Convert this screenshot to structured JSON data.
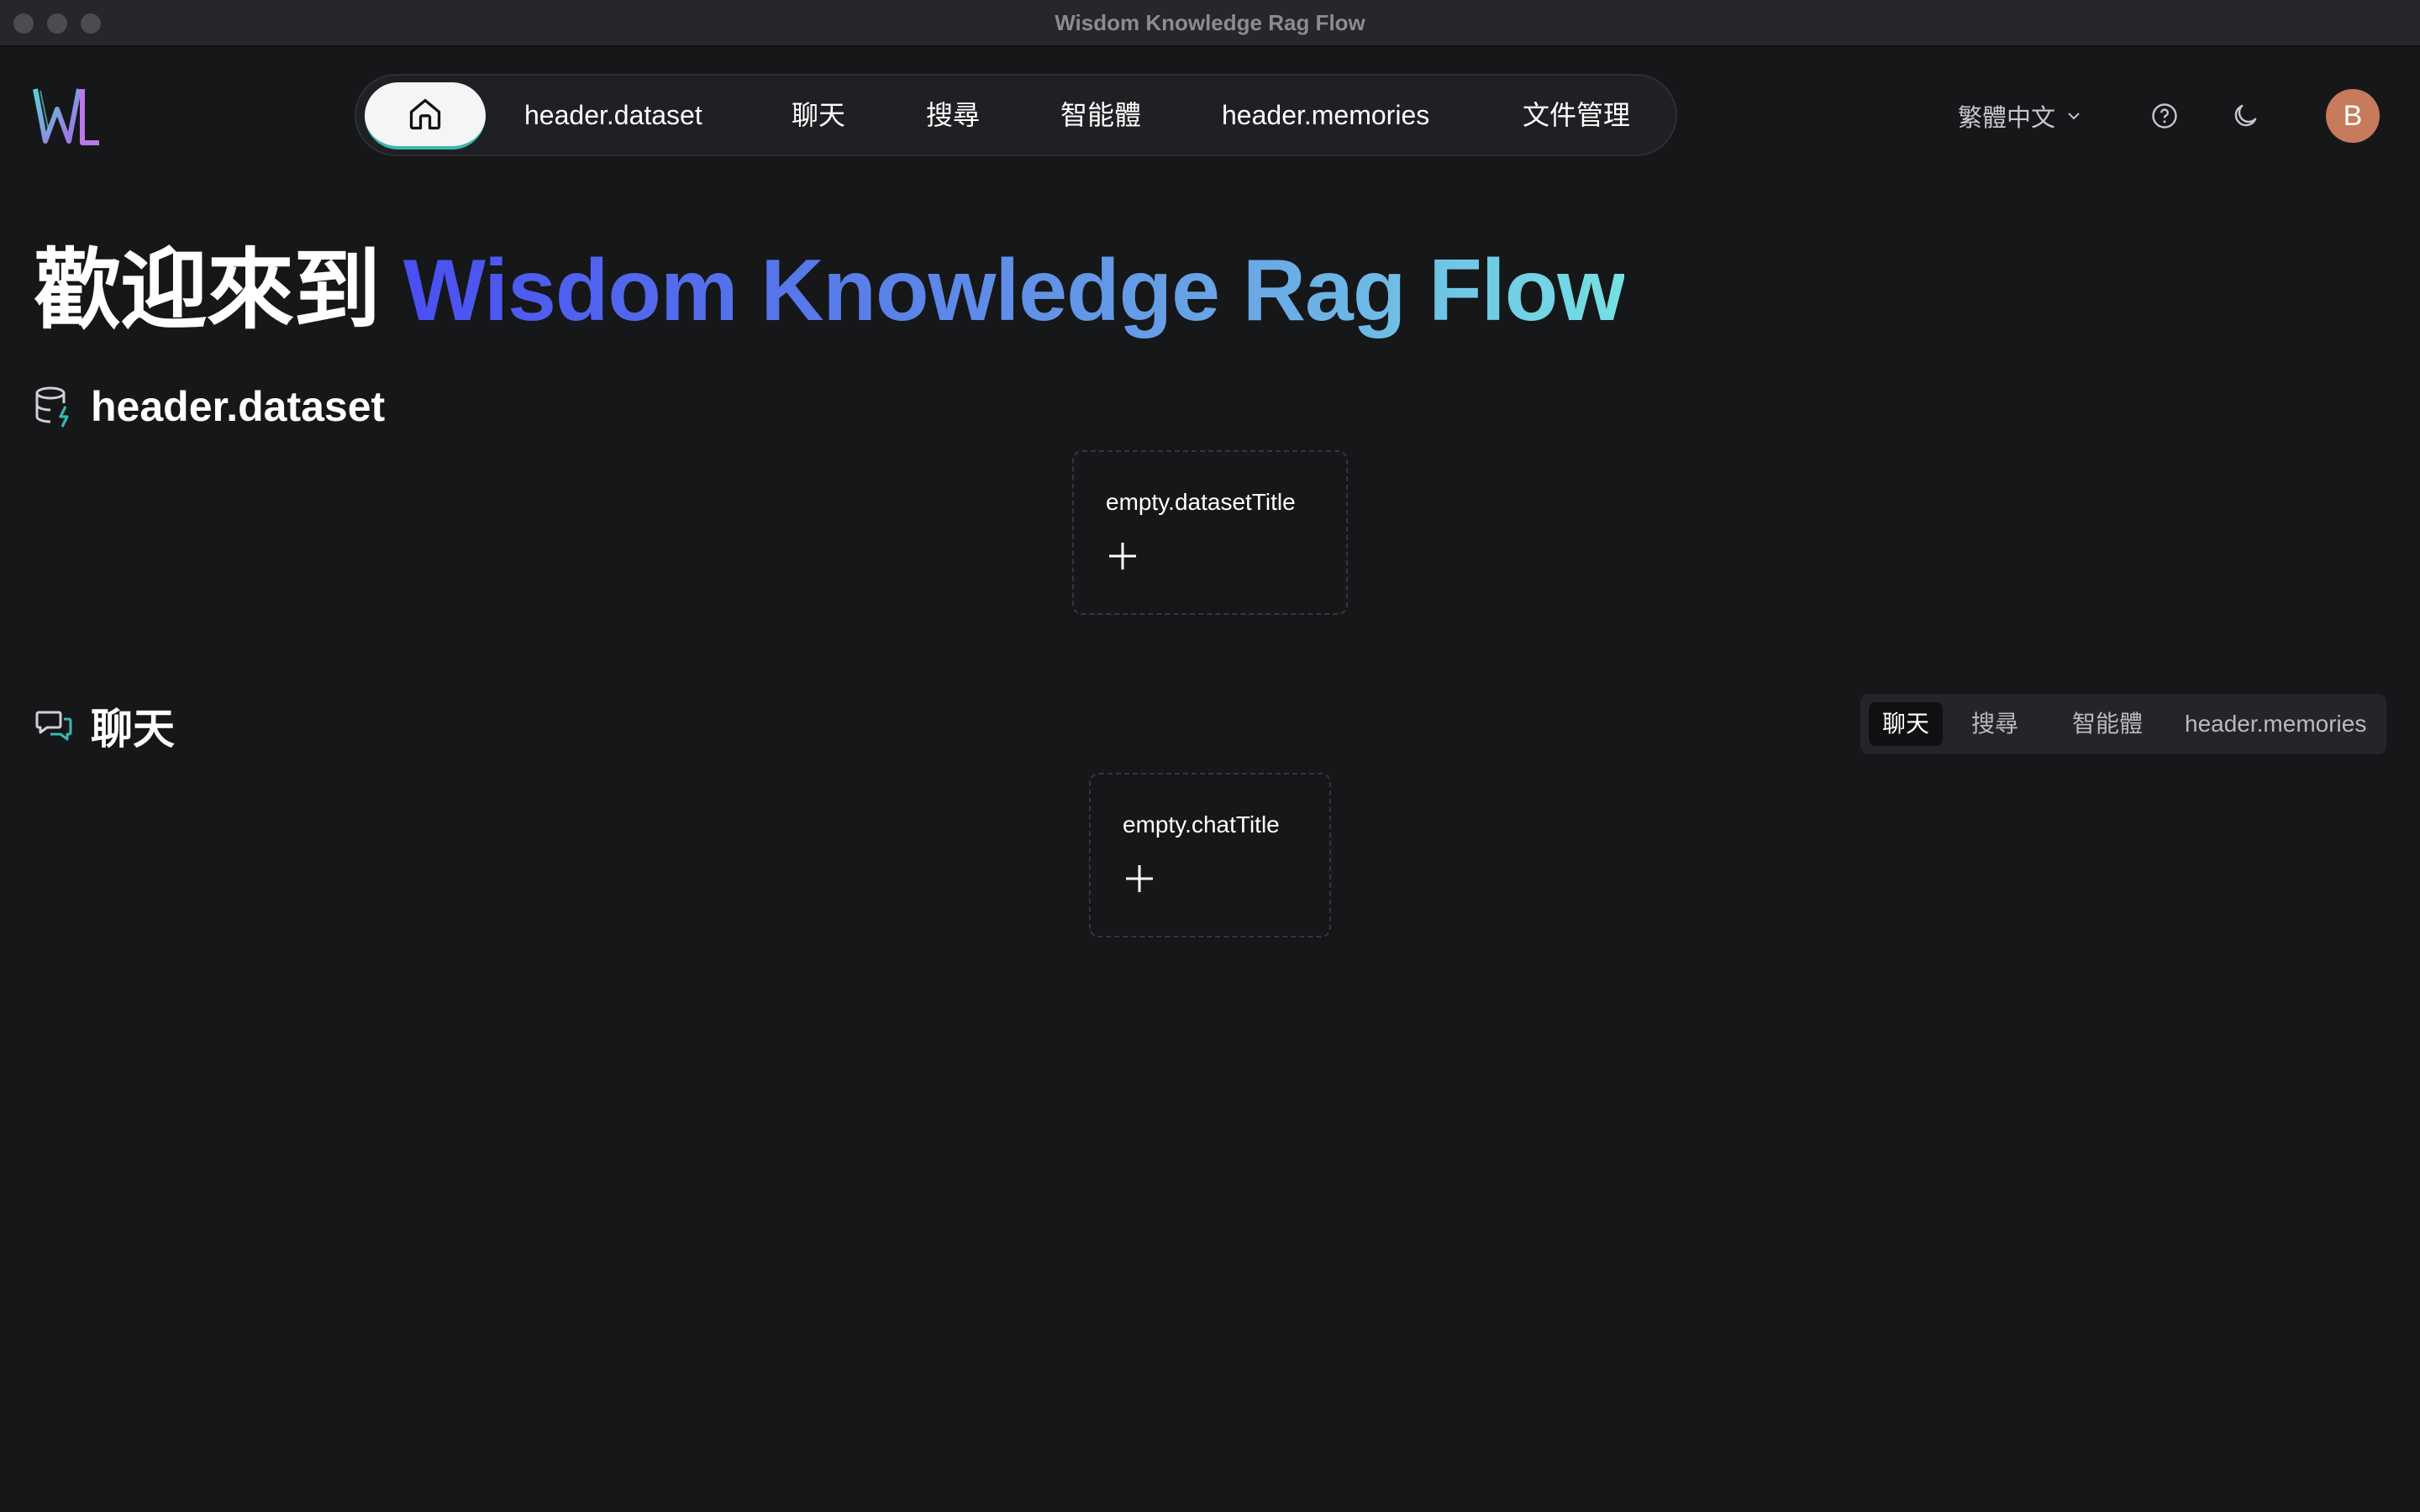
{
  "window": {
    "title": "Wisdom Knowledge Rag Flow"
  },
  "header": {
    "nav": {
      "home_icon": "home-icon",
      "items": [
        "header.dataset",
        "聊天",
        "搜尋",
        "智能體",
        "header.memories",
        "文件管理"
      ]
    },
    "language": "繁體中文",
    "help_icon": "question-circle-icon",
    "theme_icon": "moon-icon",
    "avatar_initial": "B"
  },
  "welcome": {
    "prefix": "歡迎來到",
    "brand": "Wisdom Knowledge Rag Flow",
    "gradient_colors": [
      "#4a4ff2",
      "#74e0e4"
    ]
  },
  "dataset_section": {
    "icon": "database-icon",
    "title": "header.dataset",
    "empty_title": "empty.datasetTitle"
  },
  "chat_section": {
    "icon": "chat-bubbles-icon",
    "title": "聊天",
    "tabs": [
      "聊天",
      "搜尋",
      "智能體",
      "header.memories"
    ],
    "active_tab": "聊天",
    "empty_title": "empty.chatTitle"
  },
  "colors": {
    "background": "#161719",
    "accent_teal": "#3ab7b0",
    "avatar": "#c77a5c"
  }
}
